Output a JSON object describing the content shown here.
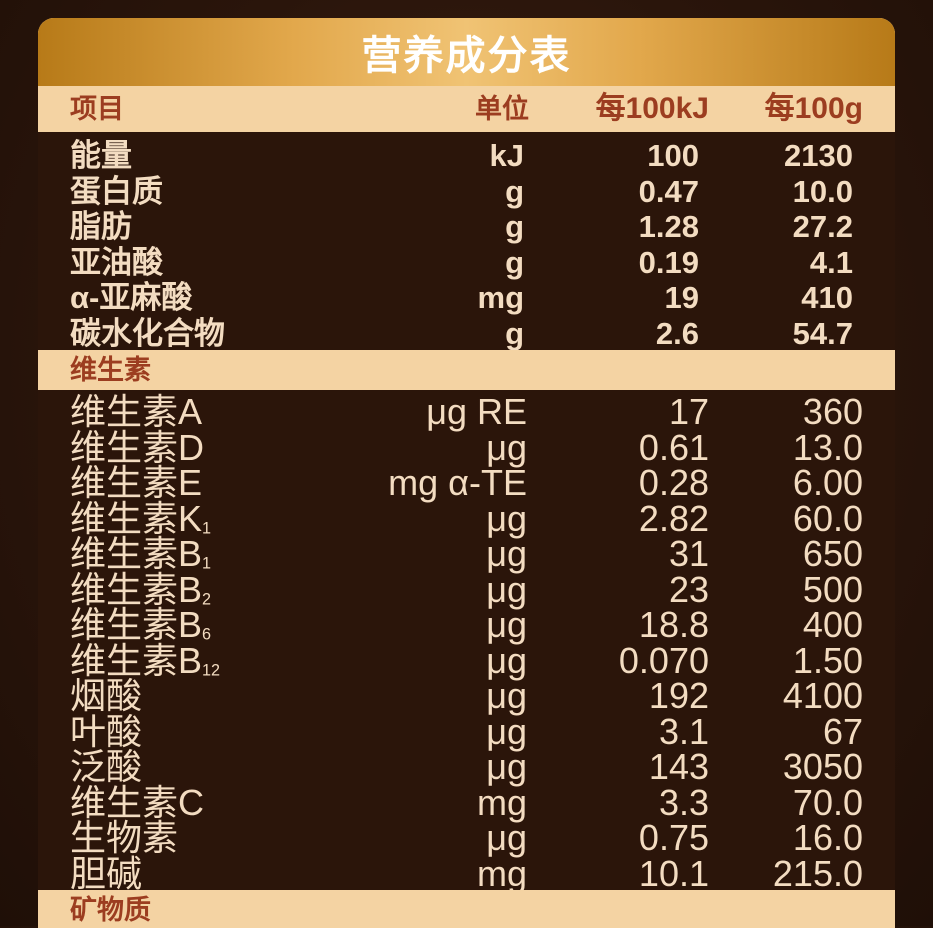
{
  "title": "营养成分表",
  "header": {
    "item": "项目",
    "unit": "单位",
    "per_kj": "每100kJ",
    "per_g": "每100g"
  },
  "main_rows": [
    {
      "name": "能量",
      "unit": "kJ",
      "per_kj": "100",
      "per_g": "2130"
    },
    {
      "name": "蛋白质",
      "unit": "g",
      "per_kj": "0.47",
      "per_g": "10.0"
    },
    {
      "name": "脂肪",
      "unit": "g",
      "per_kj": "1.28",
      "per_g": "27.2"
    },
    {
      "name": "亚油酸",
      "unit": "g",
      "per_kj": "0.19",
      "per_g": "4.1"
    },
    {
      "name": "α-亚麻酸",
      "unit": "mg",
      "per_kj": "19",
      "per_g": "410"
    },
    {
      "name": "碳水化合物",
      "unit": "g",
      "per_kj": "2.6",
      "per_g": "54.7"
    }
  ],
  "vitamin_section": {
    "label": "维生素",
    "rows": [
      {
        "name": "维生素A",
        "sub": "",
        "unit": "μg RE",
        "per_kj": "17",
        "per_g": "360"
      },
      {
        "name": "维生素D",
        "sub": "",
        "unit": "μg",
        "per_kj": "0.61",
        "per_g": "13.0"
      },
      {
        "name": "维生素E",
        "sub": "",
        "unit": "mg α-TE",
        "per_kj": "0.28",
        "per_g": "6.00"
      },
      {
        "name": "维生素K",
        "sub": "1",
        "unit": "μg",
        "per_kj": "2.82",
        "per_g": "60.0"
      },
      {
        "name": "维生素B",
        "sub": "1",
        "unit": "μg",
        "per_kj": "31",
        "per_g": "650"
      },
      {
        "name": "维生素B",
        "sub": "2",
        "unit": "μg",
        "per_kj": "23",
        "per_g": "500"
      },
      {
        "name": "维生素B",
        "sub": "6",
        "unit": "μg",
        "per_kj": "18.8",
        "per_g": "400"
      },
      {
        "name": "维生素B",
        "sub": "12",
        "unit": "μg",
        "per_kj": "0.070",
        "per_g": "1.50"
      },
      {
        "name": "烟酸",
        "sub": "",
        "unit": "μg",
        "per_kj": "192",
        "per_g": "4100"
      },
      {
        "name": "叶酸",
        "sub": "",
        "unit": "μg",
        "per_kj": "3.1",
        "per_g": "67"
      },
      {
        "name": "泛酸",
        "sub": "",
        "unit": "μg",
        "per_kj": "143",
        "per_g": "3050"
      },
      {
        "name": "维生素C",
        "sub": "",
        "unit": "mg",
        "per_kj": "3.3",
        "per_g": "70.0"
      },
      {
        "name": "生物素",
        "sub": "",
        "unit": "μg",
        "per_kj": "0.75",
        "per_g": "16.0"
      },
      {
        "name": "胆碱",
        "sub": "",
        "unit": "mg",
        "per_kj": "10.1",
        "per_g": "215.0"
      }
    ]
  },
  "mineral_section": {
    "label": "矿物质"
  },
  "colors": {
    "title_gold": "#e2a84c",
    "cream": "#f4d3a3",
    "header_text": "#9c3d20",
    "dark_bg": "#2b150a",
    "body_text": "#f3dcc1"
  }
}
